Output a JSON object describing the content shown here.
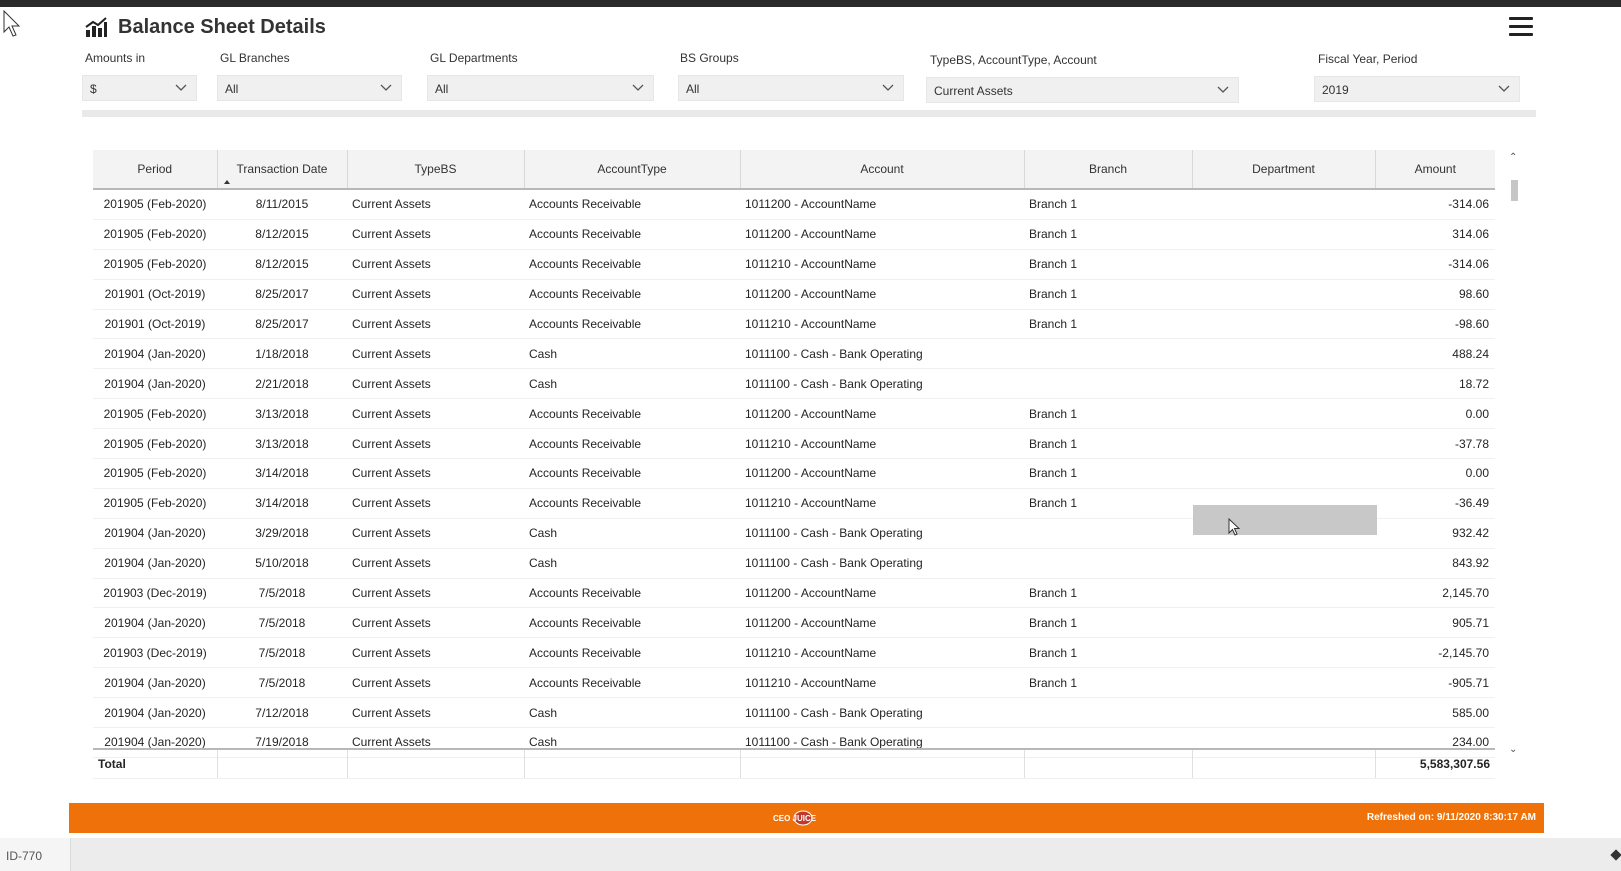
{
  "header": {
    "title": "Balance Sheet Details",
    "chart_icon": "bar-chart-icon",
    "menu_icon": "hamburger-menu-icon"
  },
  "filters": [
    {
      "label": "Amounts in",
      "value": "$"
    },
    {
      "label": "GL Branches",
      "value": "All"
    },
    {
      "label": "GL Departments",
      "value": "All"
    },
    {
      "label": "BS Groups",
      "value": "All"
    },
    {
      "label": "TypeBS, AccountType, Account",
      "value": "Current Assets"
    },
    {
      "label": "Fiscal Year, Period",
      "value": "2019"
    }
  ],
  "table": {
    "columns": [
      "Period",
      "Transaction Date",
      "TypeBS",
      "AccountType",
      "Account",
      "Branch",
      "Department",
      "Amount"
    ],
    "rows": [
      [
        "201905 (Feb-2020)",
        "8/11/2015",
        "Current Assets",
        "Accounts Receivable",
        "1011200 - AccountName",
        "Branch 1",
        "",
        "-314.06"
      ],
      [
        "201905 (Feb-2020)",
        "8/12/2015",
        "Current Assets",
        "Accounts Receivable",
        "1011200 - AccountName",
        "Branch 1",
        "",
        "314.06"
      ],
      [
        "201905 (Feb-2020)",
        "8/12/2015",
        "Current Assets",
        "Accounts Receivable",
        "1011210 - AccountName",
        "Branch 1",
        "",
        "-314.06"
      ],
      [
        "201901 (Oct-2019)",
        "8/25/2017",
        "Current Assets",
        "Accounts Receivable",
        "1011200 - AccountName",
        "Branch 1",
        "",
        "98.60"
      ],
      [
        "201901 (Oct-2019)",
        "8/25/2017",
        "Current Assets",
        "Accounts Receivable",
        "1011210 - AccountName",
        "Branch 1",
        "",
        "-98.60"
      ],
      [
        "201904 (Jan-2020)",
        "1/18/2018",
        "Current Assets",
        "Cash",
        "1011100 - Cash - Bank Operating",
        "",
        "",
        "488.24"
      ],
      [
        "201904 (Jan-2020)",
        "2/21/2018",
        "Current Assets",
        "Cash",
        "1011100 - Cash - Bank Operating",
        "",
        "",
        "18.72"
      ],
      [
        "201905 (Feb-2020)",
        "3/13/2018",
        "Current Assets",
        "Accounts Receivable",
        "1011200 - AccountName",
        "Branch 1",
        "",
        "0.00"
      ],
      [
        "201905 (Feb-2020)",
        "3/13/2018",
        "Current Assets",
        "Accounts Receivable",
        "1011210 - AccountName",
        "Branch 1",
        "",
        "-37.78"
      ],
      [
        "201905 (Feb-2020)",
        "3/14/2018",
        "Current Assets",
        "Accounts Receivable",
        "1011200 - AccountName",
        "Branch 1",
        "",
        "0.00"
      ],
      [
        "201905 (Feb-2020)",
        "3/14/2018",
        "Current Assets",
        "Accounts Receivable",
        "1011210 - AccountName",
        "Branch 1",
        "",
        "-36.49"
      ],
      [
        "201904 (Jan-2020)",
        "3/29/2018",
        "Current Assets",
        "Cash",
        "1011100 - Cash - Bank Operating",
        "",
        "",
        "932.42"
      ],
      [
        "201904 (Jan-2020)",
        "5/10/2018",
        "Current Assets",
        "Cash",
        "1011100 - Cash - Bank Operating",
        "",
        "",
        "843.92"
      ],
      [
        "201903 (Dec-2019)",
        "7/5/2018",
        "Current Assets",
        "Accounts Receivable",
        "1011200 - AccountName",
        "Branch 1",
        "",
        "2,145.70"
      ],
      [
        "201904 (Jan-2020)",
        "7/5/2018",
        "Current Assets",
        "Accounts Receivable",
        "1011200 - AccountName",
        "Branch 1",
        "",
        "905.71"
      ],
      [
        "201903 (Dec-2019)",
        "7/5/2018",
        "Current Assets",
        "Accounts Receivable",
        "1011210 - AccountName",
        "Branch 1",
        "",
        "-2,145.70"
      ],
      [
        "201904 (Jan-2020)",
        "7/5/2018",
        "Current Assets",
        "Accounts Receivable",
        "1011210 - AccountName",
        "Branch 1",
        "",
        "-905.71"
      ],
      [
        "201904 (Jan-2020)",
        "7/12/2018",
        "Current Assets",
        "Cash",
        "1011100 - Cash - Bank Operating",
        "",
        "",
        "585.00"
      ],
      [
        "201904 (Jan-2020)",
        "7/19/2018",
        "Current Assets",
        "Cash",
        "1011100 - Cash - Bank Operating",
        "",
        "",
        "234.00"
      ]
    ],
    "total_label": "Total",
    "total_amount": "5,583,307.56"
  },
  "footer": {
    "logo_text": "CEO JUICE",
    "refreshed": "Refreshed on: 9/11/2020 8:30:17 AM",
    "color": "#ee7209"
  },
  "status": {
    "id": "ID-770"
  }
}
